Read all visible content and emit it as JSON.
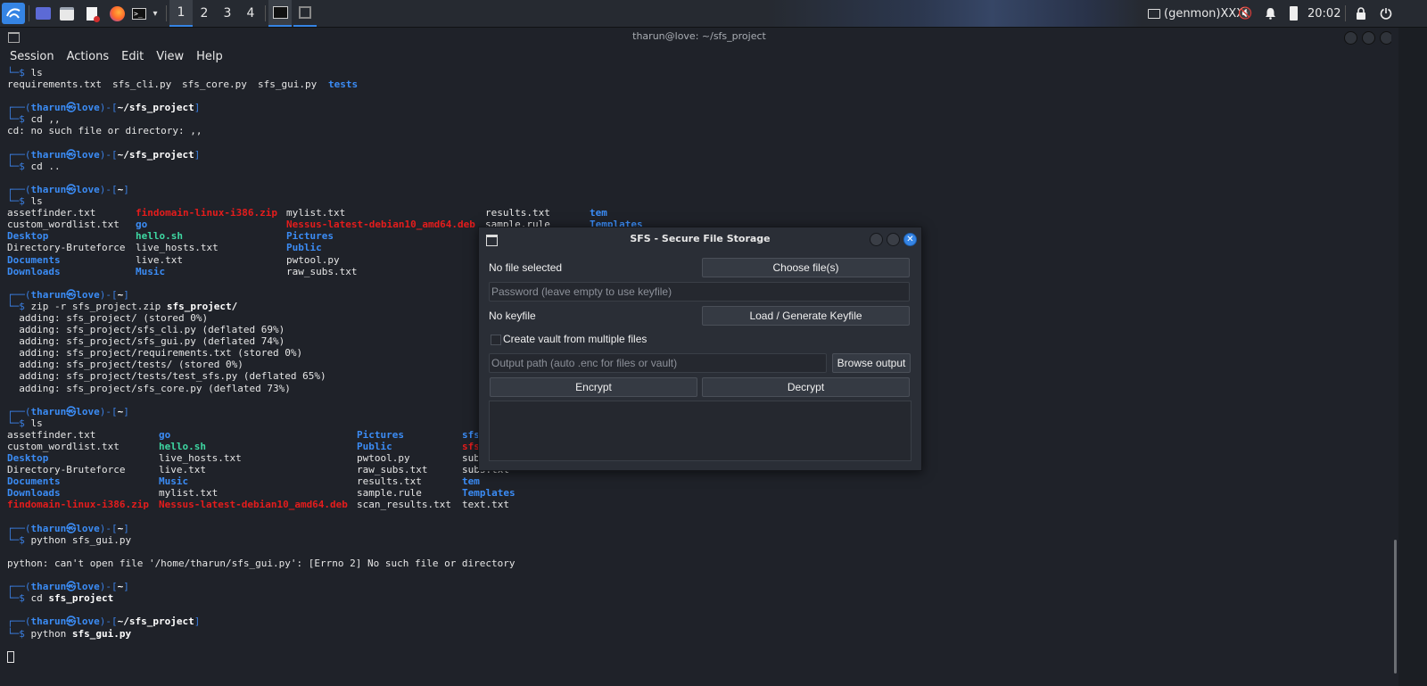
{
  "panel": {
    "workspaces": [
      "1",
      "2",
      "3",
      "4"
    ],
    "tray_text": "(genmon)XXX",
    "clock": "20:02",
    "accent": "#3584e4"
  },
  "terminal": {
    "title": "tharun@love: ~/sfs_project",
    "menu": [
      "Session",
      "Actions",
      "Edit",
      "View",
      "Help"
    ],
    "prompt": {
      "top": "┌──(",
      "user": "tharun㉿love",
      "mid": ")-[",
      "end": "]",
      "bottom": "└─$ "
    },
    "paths": {
      "project": "~/sfs_project",
      "home": "~"
    },
    "commands": {
      "ls": "ls",
      "cd_commas": "cd ,,",
      "cd_up": "cd ..",
      "zip": "zip -r sfs_project.zip ",
      "zip_target": "sfs_project/",
      "python": "python sfs_gui.py",
      "cd_project": "cd ",
      "cd_project_target": "sfs_project",
      "python2": "python ",
      "python2_target": "sfs_gui.py"
    },
    "ls1": [
      "requirements.txt",
      "sfs_cli.py",
      "sfs_core.py",
      "sfs_gui.py",
      "tests"
    ],
    "cd_error": "cd: no such file or directory: ,,",
    "ls2": {
      "c1": [
        "assetfinder.txt",
        "custom_wordlist.txt",
        "Desktop",
        "Directory-Bruteforce",
        "Documents",
        "Downloads"
      ],
      "c2": [
        "findomain-linux-i386.zip",
        "go",
        "hello.sh",
        "live_hosts.txt",
        "live.txt",
        "Music"
      ],
      "c3": [
        "mylist.txt",
        "Nessus-latest-debian10_amd64.deb",
        "Pictures",
        "Public",
        "pwtool.py",
        "raw_subs.txt"
      ],
      "c4": [
        "results.txt",
        "sample.rule"
      ],
      "c5": [
        "tem",
        "Templates"
      ]
    },
    "zip_output": [
      "  adding: sfs_project/ (stored 0%)",
      "  adding: sfs_project/sfs_cli.py (deflated 69%)",
      "  adding: sfs_project/sfs_gui.py (deflated 74%)",
      "  adding: sfs_project/requirements.txt (stored 0%)",
      "  adding: sfs_project/tests/ (stored 0%)",
      "  adding: sfs_project/tests/test_sfs.py (deflated 65%)",
      "  adding: sfs_project/sfs_core.py (deflated 73%)"
    ],
    "ls3": {
      "c1": [
        "assetfinder.txt",
        "custom_wordlist.txt",
        "Desktop",
        "Directory-Bruteforce",
        "Documents",
        "Downloads",
        "findomain-linux-i386.zip"
      ],
      "c2": [
        "go",
        "hello.sh",
        "live_hosts.txt",
        "live.txt",
        "Music",
        "mylist.txt",
        "Nessus-latest-debian10_amd64.deb"
      ],
      "c3": [
        "Pictures",
        "Public",
        "pwtool.py",
        "raw_subs.txt",
        "results.txt",
        "sample.rule",
        "scan_results.txt"
      ],
      "c4": [
        "sfs",
        "sfs",
        "sub",
        "subs.txt",
        "tem",
        "Templates",
        "text.txt"
      ]
    },
    "python_error": "python: can't open file '/home/tharun/sfs_gui.py': [Errno 2] No such file or directory"
  },
  "dialog": {
    "title": "SFS - Secure File Storage",
    "file_status": "No file selected",
    "choose_button": "Choose file(s)",
    "password_placeholder": "Password (leave empty to use keyfile)",
    "keyfile_status": "No keyfile",
    "keyfile_button": "Load / Generate Keyfile",
    "vault_checkbox": "Create vault from multiple files",
    "output_placeholder": "Output path (auto .enc for files or vault)",
    "browse_button": "Browse output",
    "encrypt_button": "Encrypt",
    "decrypt_button": "Decrypt",
    "close_color": "#3584e4"
  }
}
